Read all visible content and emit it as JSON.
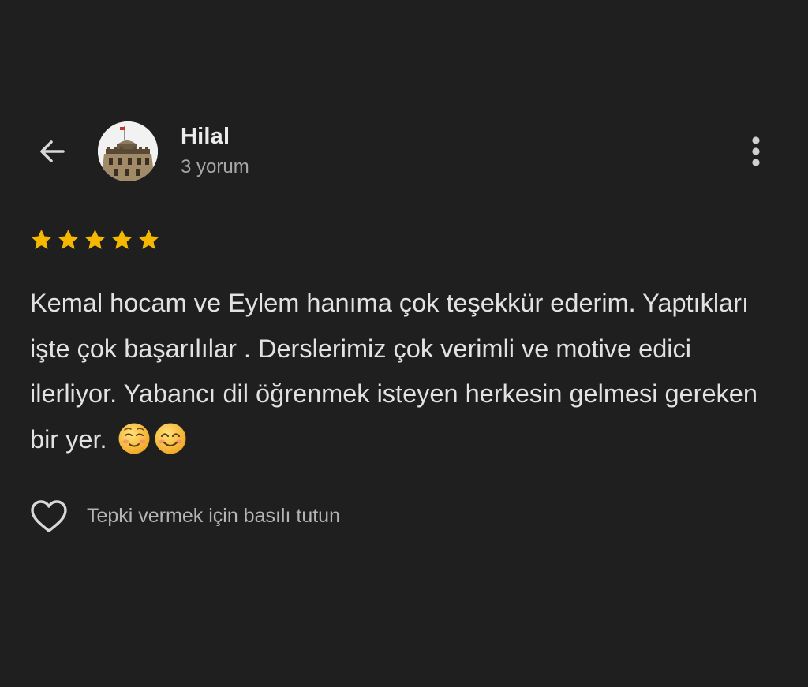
{
  "header": {
    "user_name": "Hilal",
    "review_count": "3 yorum",
    "back_icon": "arrow-left-icon",
    "more_icon": "more-vert-icon",
    "avatar_icon": "tower-photo-avatar"
  },
  "rating": {
    "stars": 5,
    "max": 5,
    "color": "#f5b800"
  },
  "review": {
    "text": "Kemal hocam ve Eylem hanıma çok teşekkür ederim. Yaptıkları işte çok başarılılar . Derslerimiz çok verimli ve motive edici ilerliyor. Yabancı dil öğrenmek isteyen herkesin gelmesi gereken bir yer.",
    "emojis": [
      "☺️",
      "😊"
    ]
  },
  "reaction": {
    "hint": "Tepki vermek için basılı tutun",
    "icon": "heart-outline-icon"
  },
  "colors": {
    "background": "#1f1f1f",
    "text": "#e2e2e2",
    "secondary_text": "#a7a7a7",
    "star": "#f5b800"
  }
}
